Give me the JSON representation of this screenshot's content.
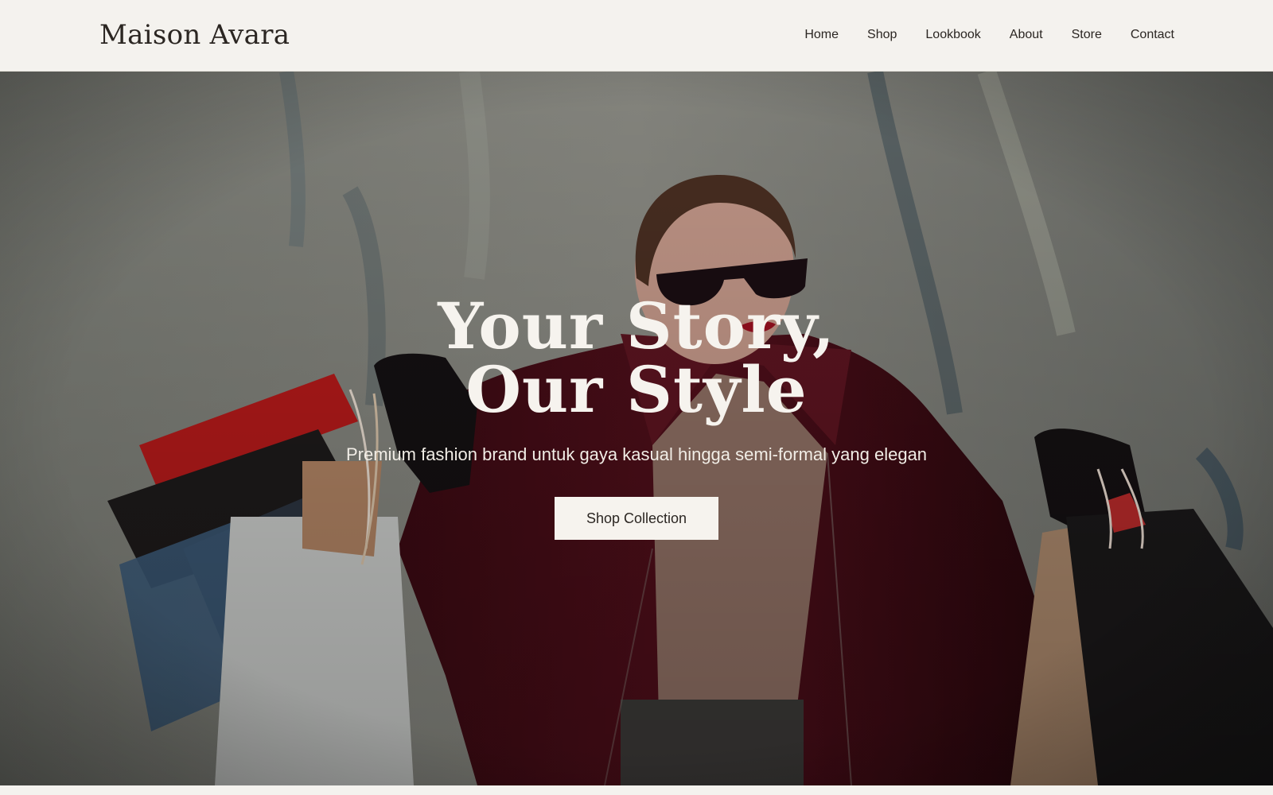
{
  "header": {
    "brand": "Maison Avara",
    "nav": [
      {
        "label": "Home"
      },
      {
        "label": "Shop"
      },
      {
        "label": "Lookbook"
      },
      {
        "label": "About"
      },
      {
        "label": "Store"
      },
      {
        "label": "Contact"
      }
    ]
  },
  "hero": {
    "title_line1": "Your Story,",
    "title_line2": "Our Style",
    "subtitle": "Premium fashion brand untuk gaya kasual hingga semi-formal yang elegan",
    "cta_label": "Shop Collection",
    "image_icon": "photo-woman-shopping-bags"
  },
  "colors": {
    "background": "#f4f2ee",
    "text": "#2b2622",
    "hero_text": "#f6f3ee",
    "coat": "#4a0d16",
    "bag_red": "#b31a1a"
  }
}
